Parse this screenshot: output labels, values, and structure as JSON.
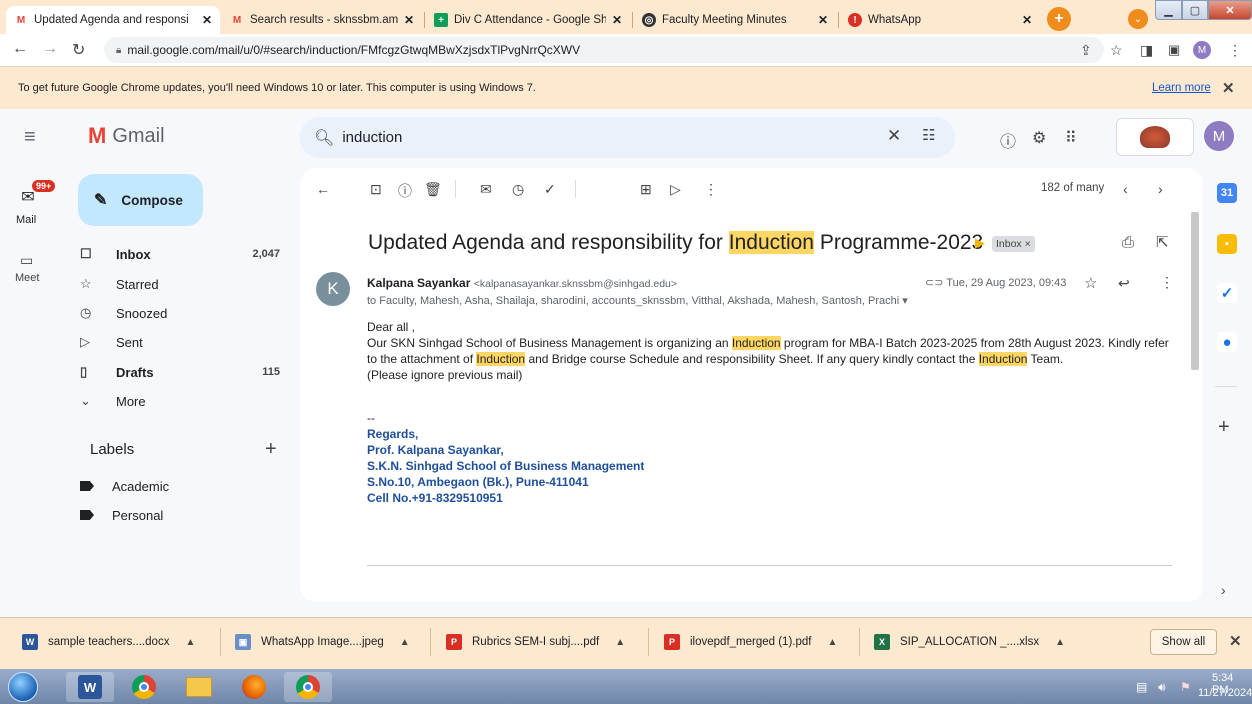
{
  "browser": {
    "tabs": [
      {
        "title": "Updated Agenda and responsi",
        "icon": "gmail-icon"
      },
      {
        "title": "Search results - sknssbm.amc",
        "icon": "gmail-icon"
      },
      {
        "title": "Div C Attendance - Google Sh",
        "icon": "sheets-icon"
      },
      {
        "title": "Faculty Meeting Minutes",
        "icon": "globe-icon"
      },
      {
        "title": "WhatsApp",
        "icon": "whatsapp-icon"
      }
    ],
    "url": "mail.google.com/mail/u/0/#search/induction/FMfcgzGtwqMBwXzjsdxTlPvgNrrQcXWV",
    "profile_initial": "M"
  },
  "banner": {
    "text": "To get future Google Chrome updates, you'll need Windows 10 or later. This computer is using Windows 7.",
    "link": "Learn more"
  },
  "gmail": {
    "logo_text": "Gmail",
    "search_value": "induction",
    "account_initial": "M",
    "rail": {
      "mail_label": "Mail",
      "badge": "99+",
      "meet_label": "Meet"
    },
    "compose_label": "Compose",
    "nav": [
      {
        "label": "Inbox",
        "count": "2,047",
        "icon": "inbox-icon",
        "bold": true
      },
      {
        "label": "Starred",
        "count": "",
        "icon": "star-icon",
        "bold": false
      },
      {
        "label": "Snoozed",
        "count": "",
        "icon": "clock-icon",
        "bold": false
      },
      {
        "label": "Sent",
        "count": "",
        "icon": "send-icon",
        "bold": false
      },
      {
        "label": "Drafts",
        "count": "115",
        "icon": "draft-icon",
        "bold": true
      },
      {
        "label": "More",
        "count": "",
        "icon": "chevron-down-icon",
        "bold": false
      }
    ],
    "labels_heading": "Labels",
    "labels": [
      "Academic",
      "Personal"
    ]
  },
  "message": {
    "pager": "182 of many",
    "subject_before": "Updated Agenda and responsibility for ",
    "subject_highlight": "Induction",
    "subject_after": " Programme-2023",
    "inbox_chip": "Inbox ×",
    "sender_initial": "K",
    "sender_name": "Kalpana Sayankar",
    "sender_email": "<kalpanasayankar.sknssbm@sinhgad.edu>",
    "to_line": "to Faculty, Mahesh, Asha, Shailaja, sharodini, accounts_sknssbm, Vitthal, Akshada, Mahesh, Santosh, Prachi",
    "date": "Tue, 29 Aug 2023, 09:43",
    "greeting": "Dear all ,",
    "body_1a": "Our SKN Sinhgad School of Business Management is organizing an ",
    "body_hl1": "Induction",
    "body_1b": " program for MBA-I Batch 2023-2025  from 28th  August 2023. Kindly refer to the attachment of ",
    "body_hl2": "Induction",
    "body_1c": "  and Bridge course Schedule and responsibility Sheet. If any query kindly contact the ",
    "body_hl3": "Induction",
    "body_1d": " Team.",
    "body_2": "(Please ignore previous mail)",
    "sig_dash": "--",
    "signature": [
      "Regards,",
      "Prof. Kalpana Sayankar,",
      "S.K.N. Sinhgad School of Business Management",
      "S.No.10, Ambegaon (Bk.), Pune-411041",
      "Cell No.+91-8329510951"
    ]
  },
  "downloads": {
    "items": [
      {
        "name": "sample teachers....docx",
        "type": "word-file-icon"
      },
      {
        "name": "WhatsApp Image....jpeg",
        "type": "image-file-icon"
      },
      {
        "name": "Rubrics SEM-I subj....pdf",
        "type": "pdf-file-icon"
      },
      {
        "name": "ilovepdf_merged (1).pdf",
        "type": "pdf-file-icon"
      },
      {
        "name": "SIP_ALLOCATION _....xlsx",
        "type": "excel-file-icon"
      }
    ],
    "show_all": "Show all"
  },
  "taskbar": {
    "time": "5:34 PM",
    "date": "11/27/2024"
  },
  "colors": {
    "tab_strip": "#fde8d0",
    "compose": "#c2e7ff",
    "highlight": "#fdd663",
    "signature_blue": "#1f4e9a",
    "gmail_red": "#ea4335"
  }
}
